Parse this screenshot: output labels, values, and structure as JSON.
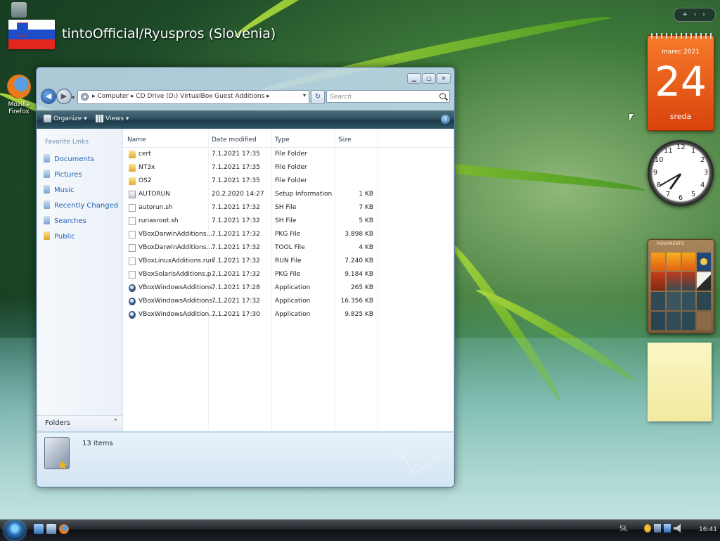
{
  "overlay": {
    "title": "tintoOfficial/Ryuspros (Slovenia)"
  },
  "desktop_icons": [
    {
      "label_line1": "Mozilla",
      "label_line2": "Firefox",
      "icon": "firefox-icon"
    }
  ],
  "window": {
    "title_buttons": {
      "minimize": "▁",
      "maximize": "▢",
      "close": "✕"
    },
    "address": {
      "crumbs": "▸  Computer  ▸  CD Drive (D:) VirtualBox Guest Additions  ▸",
      "dropdown": "▾"
    },
    "refresh_glyph": "↻",
    "search_placeholder": "Search",
    "toolbar": {
      "organize": "Organize ▾",
      "views": "Views ▾",
      "help": "?"
    },
    "nav_pane": {
      "heading": "Favorite Links",
      "items": [
        "Documents",
        "Pictures",
        "Music",
        "Recently Changed",
        "Searches",
        "Public"
      ],
      "folders_label": "Folders",
      "folders_toggle": "⌃"
    },
    "columns": [
      "Name",
      "Date modified",
      "Type",
      "Size"
    ],
    "files": [
      {
        "name": "cert",
        "date": "7.1.2021 17:35",
        "type": "File Folder",
        "size": "",
        "icon": "folder"
      },
      {
        "name": "NT3x",
        "date": "7.1.2021 17:35",
        "type": "File Folder",
        "size": "",
        "icon": "folder"
      },
      {
        "name": "OS2",
        "date": "7.1.2021 17:35",
        "type": "File Folder",
        "size": "",
        "icon": "folder"
      },
      {
        "name": "AUTORUN",
        "date": "20.2.2020 14:27",
        "type": "Setup Information",
        "size": "1 KB",
        "icon": "inf"
      },
      {
        "name": "autorun.sh",
        "date": "7.1.2021 17:32",
        "type": "SH File",
        "size": "7 KB",
        "icon": "doc"
      },
      {
        "name": "runasroot.sh",
        "date": "7.1.2021 17:32",
        "type": "SH File",
        "size": "5 KB",
        "icon": "doc"
      },
      {
        "name": "VBoxDarwinAdditions....",
        "date": "7.1.2021 17:32",
        "type": "PKG File",
        "size": "3.898 KB",
        "icon": "doc"
      },
      {
        "name": "VBoxDarwinAdditions....",
        "date": "7.1.2021 17:32",
        "type": "TOOL File",
        "size": "4 KB",
        "icon": "doc"
      },
      {
        "name": "VBoxLinuxAdditions.run",
        "date": "7.1.2021 17:32",
        "type": "RUN File",
        "size": "7.240 KB",
        "icon": "doc"
      },
      {
        "name": "VBoxSolarisAdditions.p...",
        "date": "7.1.2021 17:32",
        "type": "PKG File",
        "size": "9.184 KB",
        "icon": "doc"
      },
      {
        "name": "VBoxWindowsAdditions",
        "date": "7.1.2021 17:28",
        "type": "Application",
        "size": "265 KB",
        "icon": "app"
      },
      {
        "name": "VBoxWindowsAdditions....",
        "date": "7.1.2021 17:32",
        "type": "Application",
        "size": "16.356 KB",
        "icon": "app"
      },
      {
        "name": "VBoxWindowsAddition....",
        "date": "7.1.2021 17:30",
        "type": "Application",
        "size": "9.825 KB",
        "icon": "app"
      }
    ],
    "details": {
      "item_count": "13 items"
    }
  },
  "gadgets": {
    "sidebar_controls": "+ ‹ ›",
    "calendar": {
      "month": "marec 2021",
      "day": "24",
      "weekday": "sreda"
    },
    "clock_numbers": [
      "12",
      "1",
      "2",
      "3",
      "4",
      "5",
      "6",
      "7",
      "8",
      "9",
      "10",
      "11"
    ],
    "puzzle_title": "MOVIMIENTO"
  },
  "taskbar": {
    "language": "SL",
    "time": "16:41"
  },
  "colors": {
    "accent_blue": "#1f5fb5",
    "toolbar_dark": "#1b3745",
    "calendar_orange": "#e85a18"
  }
}
